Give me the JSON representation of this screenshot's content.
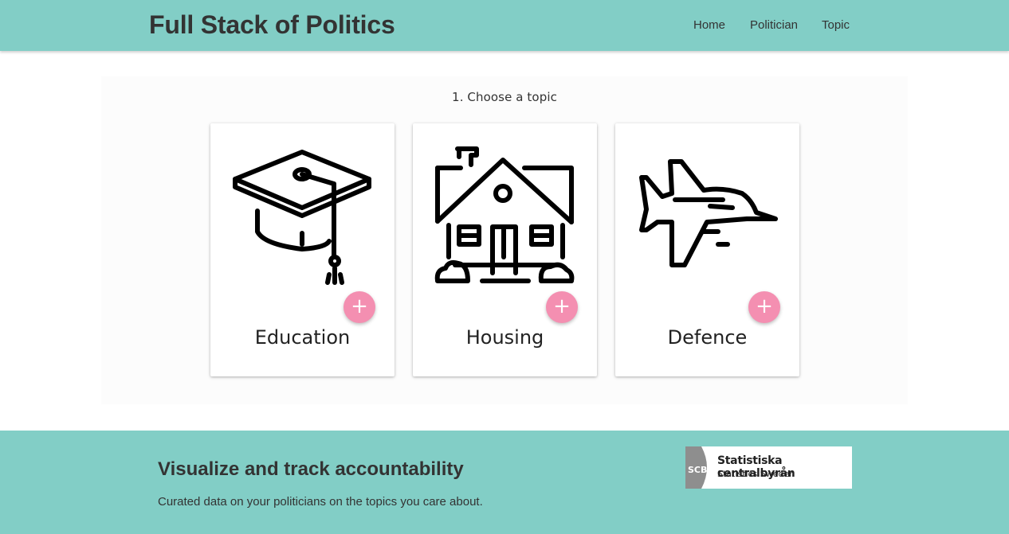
{
  "header": {
    "brand": "Full Stack of Politics",
    "nav": [
      {
        "label": "Home"
      },
      {
        "label": "Politician"
      },
      {
        "label": "Topic"
      }
    ]
  },
  "main": {
    "instruction": "1. Choose a topic",
    "topics": [
      {
        "label": "Education",
        "icon": "graduation-cap-icon",
        "action": "+"
      },
      {
        "label": "Housing",
        "icon": "house-icon",
        "action": "+"
      },
      {
        "label": "Defence",
        "icon": "fighter-jet-icon",
        "action": "+"
      }
    ]
  },
  "footer": {
    "title": "Visualize and track accountability",
    "text": "Curated data on your politicians on the topics you care about.",
    "logo": {
      "mark": "SCB",
      "name": "Statistiska centralbyrån",
      "subtitle": "Statistics Sweden"
    }
  },
  "colors": {
    "header_bg": "#82cec6",
    "footer_bg": "#82cec6",
    "accent_button": "#f48fb1"
  }
}
